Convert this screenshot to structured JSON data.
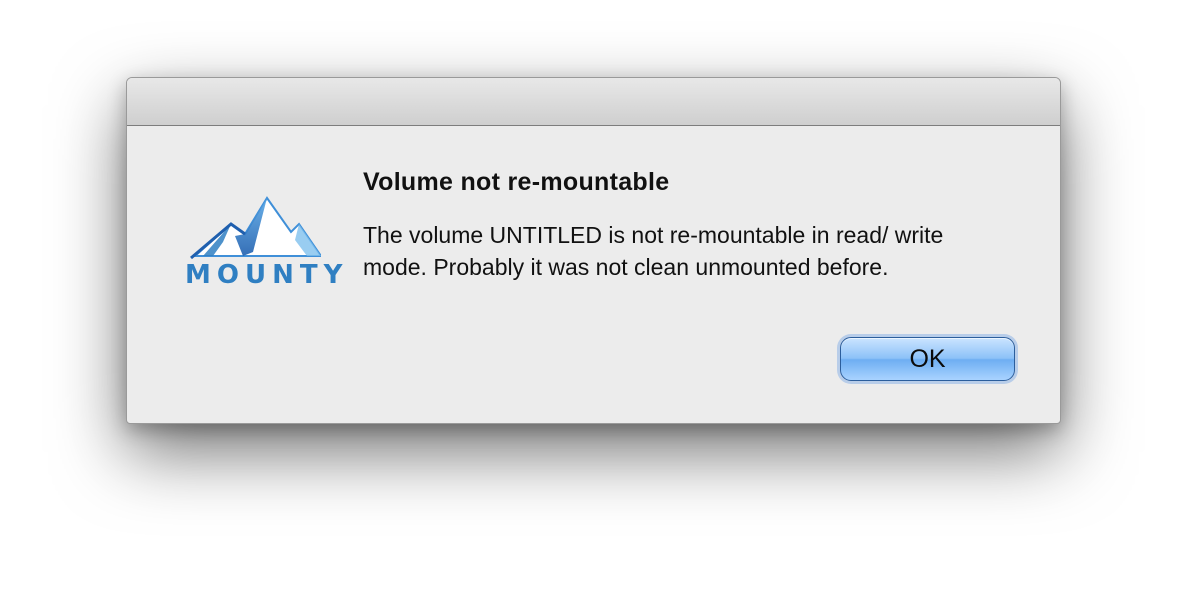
{
  "dialog": {
    "title": "Volume not re-mountable",
    "message": "The volume UNTITLED is not re-mountable in read/ write mode. Probably it was not clean unmounted before.",
    "ok_label": "OK"
  },
  "logo": {
    "wordmark": "MOUNTY",
    "icon": "mountain-logo-icon",
    "color": "#2f7fc2"
  },
  "colors": {
    "dialog_bg": "#ececec",
    "button_blue": "#8dc2f8"
  }
}
